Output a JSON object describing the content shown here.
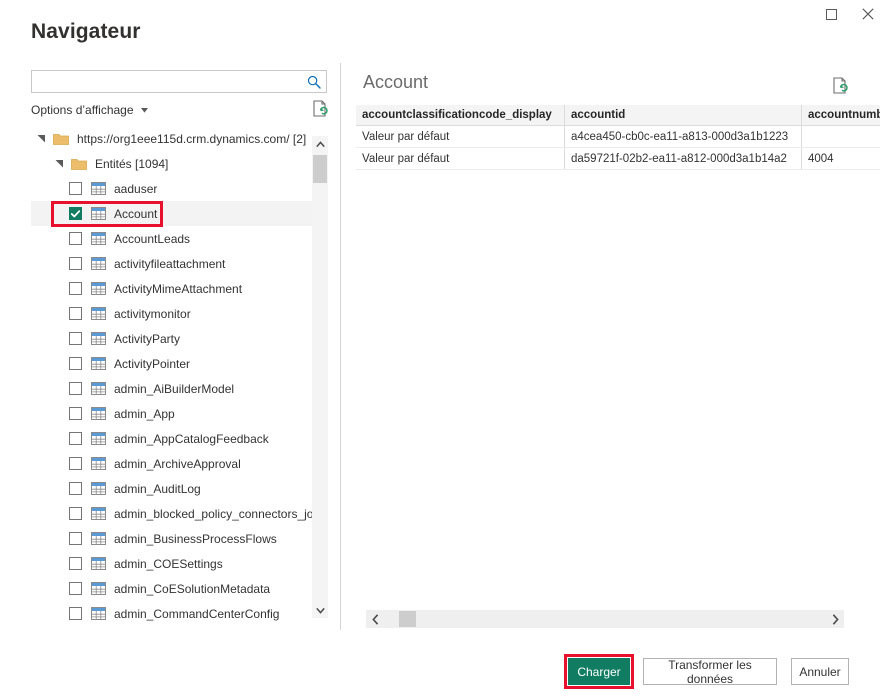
{
  "window": {
    "title": "Navigateur",
    "controls": [
      {
        "name": "maximize-button",
        "icon": "maximize-icon"
      },
      {
        "name": "close-button",
        "icon": "close-icon"
      }
    ]
  },
  "left_pane": {
    "search": {
      "value": "",
      "placeholder": "",
      "icon": "search-icon"
    },
    "display_options_label": "Options d’affichage",
    "display_options_caret": "chevron-down-icon",
    "refresh_icon": "document-refresh-icon",
    "tree": {
      "root": {
        "label": "https://org1eee115d.crm.dynamics.com/ [2]",
        "icon": "folder-icon",
        "expanded": true
      },
      "group": {
        "label": "Entités [1094]",
        "icon": "folder-icon",
        "expanded": true
      },
      "items": [
        {
          "label": "aaduser",
          "checked": false
        },
        {
          "label": "Account",
          "checked": true
        },
        {
          "label": "AccountLeads",
          "checked": false
        },
        {
          "label": "activityfileattachment",
          "checked": false
        },
        {
          "label": "ActivityMimeAttachment",
          "checked": false
        },
        {
          "label": "activitymonitor",
          "checked": false
        },
        {
          "label": "ActivityParty",
          "checked": false
        },
        {
          "label": "ActivityPointer",
          "checked": false
        },
        {
          "label": "admin_AiBuilderModel",
          "checked": false
        },
        {
          "label": "admin_App",
          "checked": false
        },
        {
          "label": "admin_AppCatalogFeedback",
          "checked": false
        },
        {
          "label": "admin_ArchiveApproval",
          "checked": false
        },
        {
          "label": "admin_AuditLog",
          "checked": false
        },
        {
          "label": "admin_blocked_policy_connectors_join",
          "checked": false
        },
        {
          "label": "admin_BusinessProcessFlows",
          "checked": false
        },
        {
          "label": "admin_COESettings",
          "checked": false
        },
        {
          "label": "admin_CoESolutionMetadata",
          "checked": false
        },
        {
          "label": "admin_CommandCenterConfig",
          "checked": false
        }
      ]
    },
    "scrollbar": {
      "up_icon": "chevron-up-icon",
      "down_icon": "chevron-down-icon"
    }
  },
  "right_pane": {
    "title": "Account",
    "refresh_icon": "document-refresh-icon",
    "table": {
      "headers": [
        "accountclassificationcode_display",
        "accountid",
        "accountnumb"
      ],
      "rows": [
        [
          "Valeur par défaut",
          "a4cea450-cb0c-ea11-a813-000d3a1b1223",
          ""
        ],
        [
          "Valeur par défaut",
          "da59721f-02b2-ea11-a812-000d3a1b14a2",
          "4004"
        ]
      ]
    },
    "scrollbar": {
      "left_icon": "chevron-left-icon",
      "right_icon": "chevron-right-icon"
    }
  },
  "footer": {
    "load_label": "Charger",
    "transform_label": "Transformer les données",
    "cancel_label": "Annuler"
  },
  "colors": {
    "accent_green": "#107c61",
    "highlight_red": "#e8112d",
    "header_bg": "#f4f4f4",
    "folder_yellow": "#ecbe6b",
    "table_icon_blue": "#5b9bd5"
  }
}
